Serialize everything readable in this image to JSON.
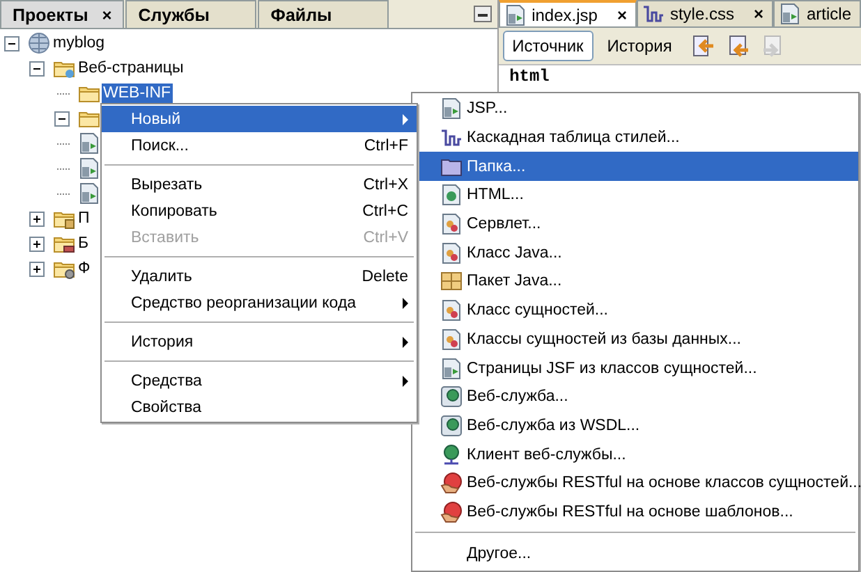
{
  "left_tabs": [
    {
      "label": "Проекты",
      "selected": true,
      "close": "×"
    },
    {
      "label": "Службы",
      "selected": false
    },
    {
      "label": "Файлы",
      "selected": false
    }
  ],
  "tree": [
    {
      "label": "myblog",
      "kind": "globe",
      "expanded": true,
      "children": [
        {
          "label": "Веб-страницы",
          "kind": "webfolder",
          "expanded": true,
          "children": [
            {
              "label": "WEB-INF",
              "kind": "folder",
              "selected": true
            },
            {
              "kind": "folder",
              "expanded": true
            },
            {
              "kind": "jspfile"
            },
            {
              "kind": "jspfile"
            },
            {
              "kind": "jspfile"
            }
          ]
        },
        {
          "label": "П",
          "kind": "pkgfolder",
          "expanded": false
        },
        {
          "label": "Б",
          "kind": "libfolder",
          "expanded": false
        },
        {
          "label": "Ф",
          "kind": "cfgfolder",
          "expanded": false
        }
      ]
    }
  ],
  "editor_tabs": [
    {
      "label": "index.jsp",
      "kind": "jspfile",
      "selected": true,
      "close": "×"
    },
    {
      "label": "style.css",
      "kind": "css",
      "selected": false,
      "close": "×"
    },
    {
      "label": "article",
      "kind": "jspfile",
      "selected": false
    }
  ],
  "editor_modes": [
    {
      "label": "Источник",
      "selected": true
    },
    {
      "label": "История",
      "selected": false
    }
  ],
  "code_lines": [
    "html"
  ],
  "context_menu": [
    {
      "kind": "item",
      "label": "Новый",
      "submenu": true,
      "selected": true,
      "disabled": false
    },
    {
      "kind": "item",
      "label": "Поиск...",
      "shortcut": "Ctrl+F",
      "selected": false,
      "disabled": false
    },
    {
      "kind": "separator"
    },
    {
      "kind": "item",
      "label": "Вырезать",
      "shortcut": "Ctrl+X",
      "selected": false,
      "disabled": false
    },
    {
      "kind": "item",
      "label": "Копировать",
      "shortcut": "Ctrl+C",
      "selected": false,
      "disabled": false
    },
    {
      "kind": "item",
      "label": "Вставить",
      "shortcut": "Ctrl+V",
      "selected": false,
      "disabled": true
    },
    {
      "kind": "separator"
    },
    {
      "kind": "item",
      "label": "Удалить",
      "shortcut": "Delete",
      "selected": false,
      "disabled": false
    },
    {
      "kind": "item",
      "label": "Средство реорганизации кода",
      "submenu": true,
      "selected": false,
      "disabled": false
    },
    {
      "kind": "separator"
    },
    {
      "kind": "item",
      "label": "История",
      "submenu": true,
      "selected": false,
      "disabled": false
    },
    {
      "kind": "separator"
    },
    {
      "kind": "item",
      "label": "Средства",
      "submenu": true,
      "selected": false,
      "disabled": false
    },
    {
      "kind": "item",
      "label": "Свойства",
      "selected": false,
      "disabled": false
    }
  ],
  "submenu": [
    {
      "kind": "jspfile",
      "label": "JSP...",
      "selected": false
    },
    {
      "kind": "css",
      "label": "Каскадная таблица стилей...",
      "selected": false
    },
    {
      "kind": "folderplain",
      "label": "Папка...",
      "selected": true
    },
    {
      "kind": "html",
      "label": "HTML...",
      "selected": false
    },
    {
      "kind": "class",
      "label": "Сервлет...",
      "selected": false
    },
    {
      "kind": "class",
      "label": "Класс Java...",
      "selected": false
    },
    {
      "kind": "package",
      "label": "Пакет Java...",
      "selected": false
    },
    {
      "kind": "class",
      "label": "Класс сущностей...",
      "selected": false
    },
    {
      "kind": "class",
      "label": "Классы сущностей из базы данных...",
      "selected": false
    },
    {
      "kind": "jspfile",
      "label": "Страницы JSF из классов сущностей...",
      "selected": false
    },
    {
      "kind": "ws",
      "label": "Веб-служба...",
      "selected": false
    },
    {
      "kind": "ws",
      "label": "Веб-служба из WSDL...",
      "selected": false
    },
    {
      "kind": "wsclient",
      "label": "Клиент веб-службы...",
      "selected": false
    },
    {
      "kind": "rest",
      "label": "Веб-службы RESTful на основе классов сущностей...",
      "selected": false
    },
    {
      "kind": "rest",
      "label": "Веб-службы RESTful на основе шаблонов...",
      "selected": false
    },
    {
      "kind": "separator"
    },
    {
      "kind": "plain",
      "label": "Другое...",
      "selected": false
    }
  ]
}
